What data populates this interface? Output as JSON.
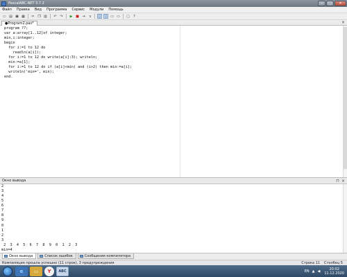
{
  "window": {
    "title": "PascalABC.NET 3.7.2",
    "minimize": "–",
    "maximize": "□",
    "close": "✕"
  },
  "menu": [
    "Файл",
    "Правка",
    "Вид",
    "Программа",
    "Сервис",
    "Модули",
    "Помощь"
  ],
  "toolbar": {
    "icons": [
      "new-icon",
      "open-icon",
      "save-icon",
      "save-all-icon",
      "print-icon",
      "cut-icon",
      "copy-icon",
      "paste-icon",
      "undo-icon",
      "redo-icon",
      "run-icon",
      "stop-icon",
      "step-icon",
      "step-over-icon",
      "layout1-icon",
      "layout2-icon",
      "layout3-icon",
      "layout4-icon",
      "form-icon",
      "help-icon"
    ]
  },
  "tab": {
    "label": "●Program2.pas*",
    "close": "×"
  },
  "editor": {
    "lines": [
      "program ??;",
      "var a:array[1..12]of integer;",
      "min,i:integer;",
      "begin",
      "  for i:=1 to 12 do",
      "    readln(a[i]);",
      "  for i:=1 to 12 do write(a[i]:3); writeln;",
      "  min:=a[1];",
      "  for i:=1 to 12 do if (a[i]<min) and (i>2) then min:=a[i];",
      "  writeln('min=', min);",
      "end."
    ]
  },
  "output_panel": {
    "title": "Окно вывода",
    "pin": "⊓",
    "close": "×"
  },
  "output": {
    "lines": [
      "2",
      "3",
      "4",
      "5",
      "6",
      "7",
      "8",
      "9",
      "0",
      "1",
      "2",
      "3",
      " 2  3  4  5  6  7  8  9  0  1  2  3",
      "min=4"
    ]
  },
  "bottom_tabs": [
    "Окно вывода",
    "Список ошибок",
    "Сообщения компилятора"
  ],
  "status": {
    "message": "Компиляция прошла успешно (11 строк), 3 предупреждения",
    "row_label": "Строка  11",
    "col_label": "Столбец  5"
  },
  "taskbar": {
    "apps": [
      {
        "name": "ie",
        "glyph": "e"
      },
      {
        "name": "folder",
        "glyph": "▭"
      },
      {
        "name": "yandex",
        "glyph": "Y"
      },
      {
        "name": "pascal",
        "glyph": "ABC"
      }
    ],
    "tray": {
      "lang": "EN",
      "time": "20:02",
      "date": "11.12.2020"
    }
  }
}
